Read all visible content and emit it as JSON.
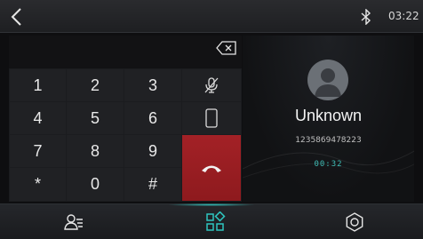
{
  "status_bar": {
    "back_icon": "chevron-left-icon",
    "bluetooth_icon": "bluetooth-icon",
    "time": "03:22"
  },
  "dialer": {
    "delete_icon": "backspace-icon",
    "keys": [
      "1",
      "2",
      "3",
      "4",
      "5",
      "6",
      "7",
      "8",
      "9",
      "*",
      "0",
      "#"
    ],
    "mute_icon": "mic-off-icon",
    "phone_icon": "phone-device-icon",
    "hangup_icon": "hang-up-icon",
    "hangup_color": "#a32126"
  },
  "call": {
    "name": "Unknown",
    "number": "1235869478223",
    "duration": "00:32",
    "accent_color": "#3fbdb6"
  },
  "bottom_nav": {
    "contacts_icon": "contacts-icon",
    "apps_icon": "apps-grid-icon",
    "settings_icon": "settings-icon"
  }
}
